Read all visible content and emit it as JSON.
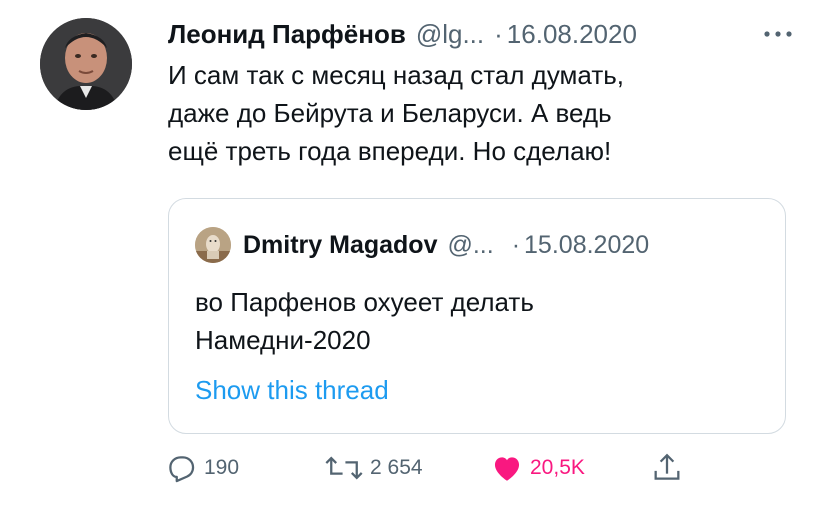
{
  "tweet": {
    "author_name": "Леонид Парфёнов",
    "handle": "@lg...",
    "separator": "·",
    "date": "16.08.2020",
    "text_lines": [
      "И сам так с месяц назад стал думать,",
      "даже до Бейрута и Беларуси. А ведь",
      "ещё треть года впереди. Но сделаю!"
    ]
  },
  "quote": {
    "author_name": "Dmitry Magadov",
    "handle": "@...",
    "separator": "·",
    "date": "15.08.2020",
    "text_lines": [
      "во Парфенов охуеет делать",
      "Намедни-2020"
    ],
    "show_thread": "Show this thread"
  },
  "actions": {
    "replies": "190",
    "retweets": "2 654",
    "likes": "20,5K"
  },
  "colors": {
    "primary_text": "#0f1419",
    "secondary_text": "#536471",
    "link": "#1d9bf0",
    "like": "#f91880",
    "border": "#d3dbe1"
  },
  "icons": {
    "more": "more-icon",
    "reply": "reply-icon",
    "retweet": "retweet-icon",
    "like": "heart-icon",
    "share": "share-icon"
  }
}
